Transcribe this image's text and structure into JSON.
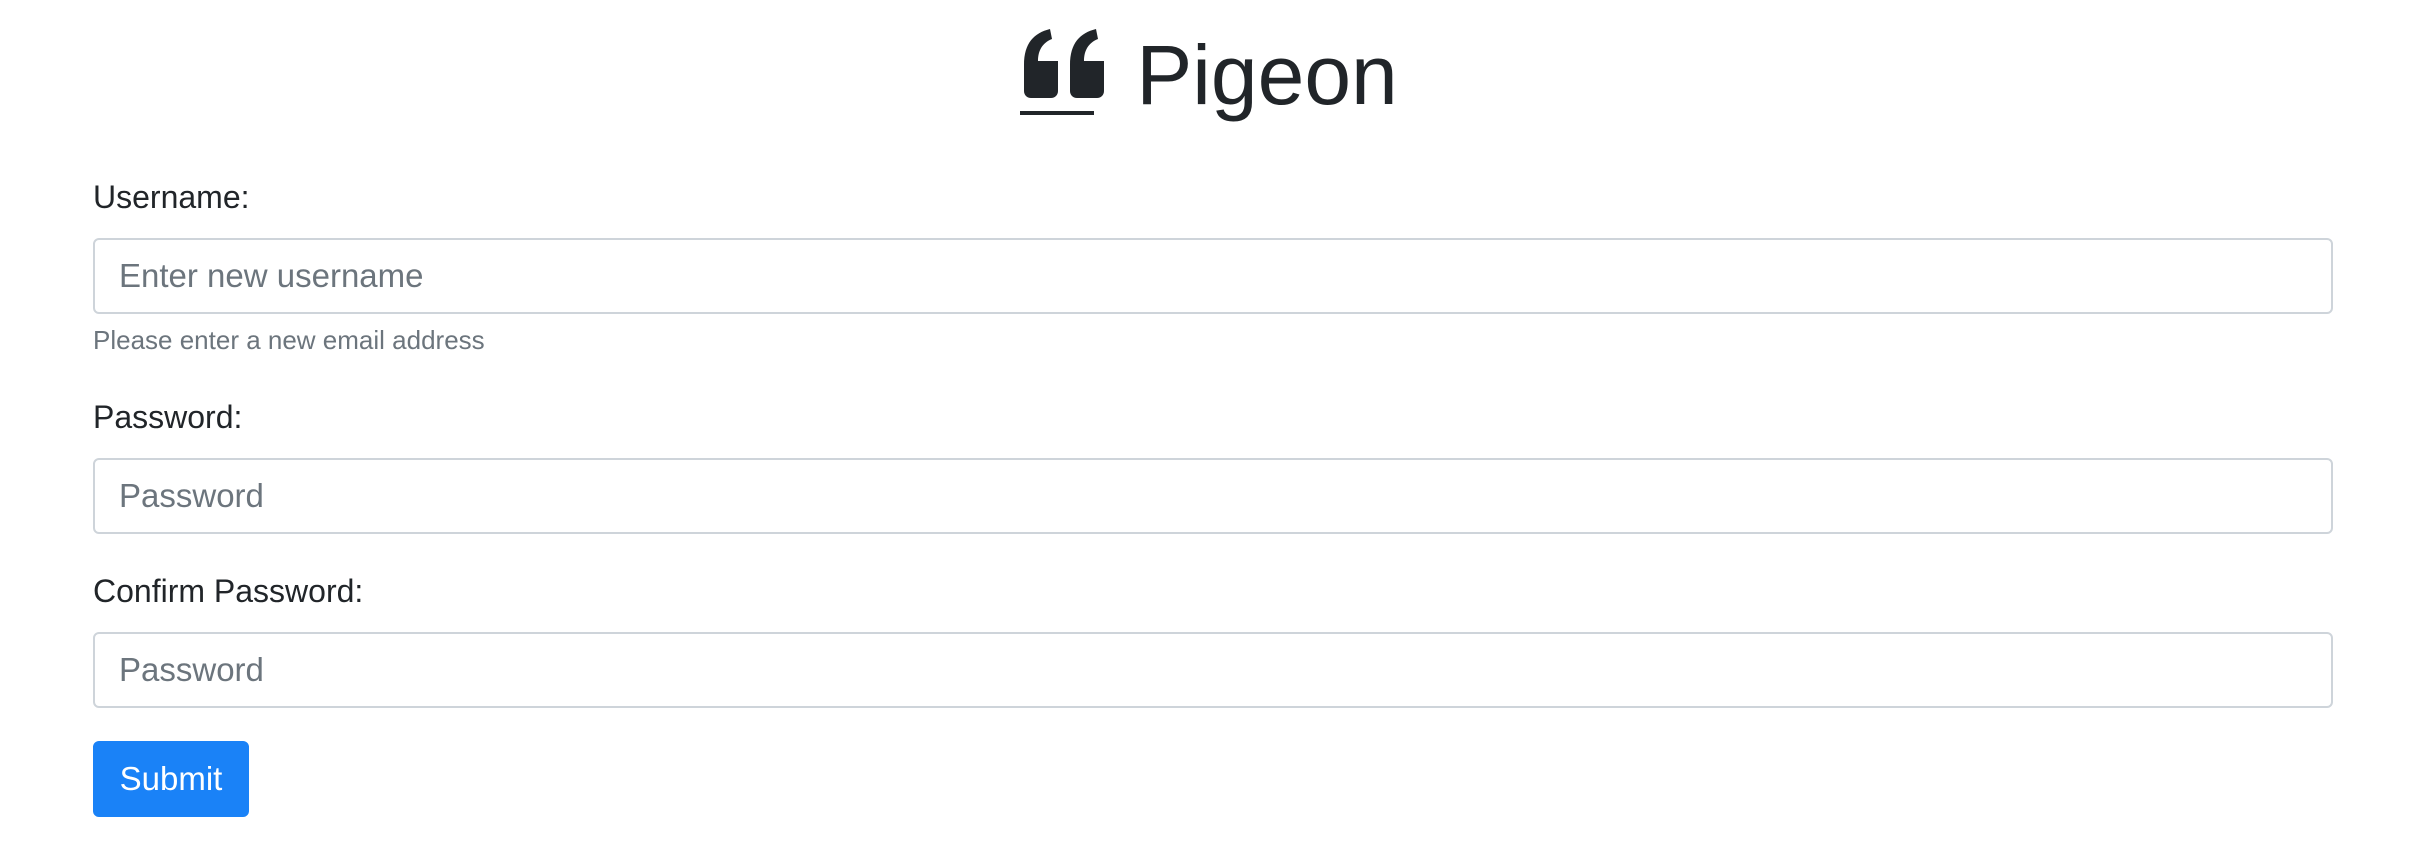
{
  "brand": {
    "icon": "quote-left-icon",
    "title": "Pigeon"
  },
  "form": {
    "username": {
      "label": "Username:",
      "placeholder": "Enter new username",
      "value": "",
      "help": "Please enter a new email address"
    },
    "password": {
      "label": "Password:",
      "placeholder": "Password",
      "value": ""
    },
    "confirm_password": {
      "label": "Confirm Password:",
      "placeholder": "Password",
      "value": ""
    },
    "submit_label": "Submit"
  },
  "colors": {
    "primary": "#1a82f7",
    "text": "#212529",
    "muted": "#6c757d",
    "border": "#ced4da"
  }
}
